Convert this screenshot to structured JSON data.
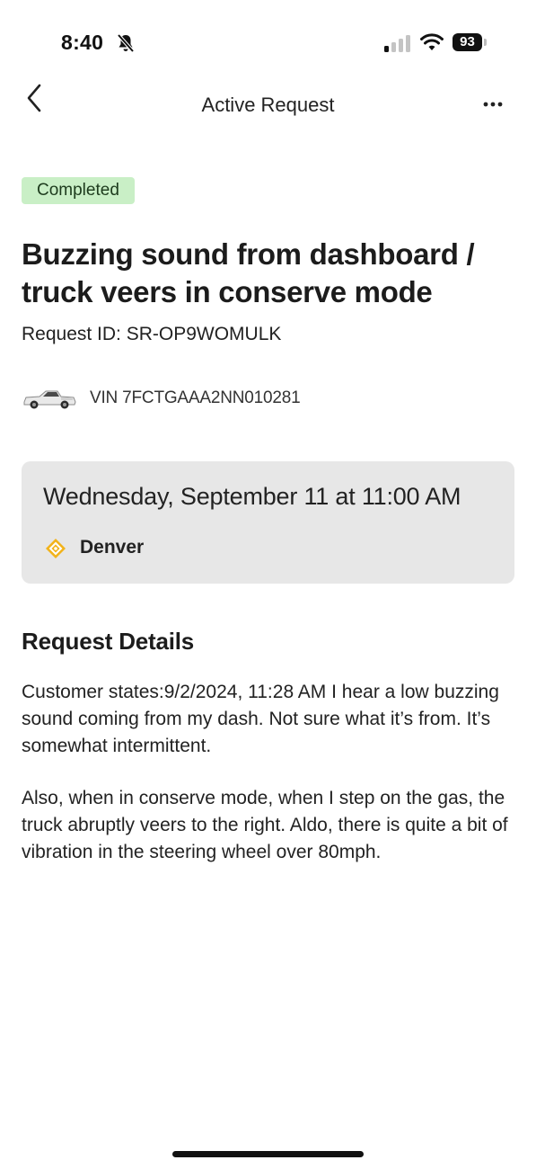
{
  "status_bar": {
    "time": "8:40",
    "battery_level": "93",
    "icons": [
      "bell-slash-icon",
      "cellular-signal-icon",
      "wifi-icon",
      "battery-icon"
    ]
  },
  "nav": {
    "title": "Active Request",
    "back_icon": "chevron-left-icon",
    "more_icon": "more-horizontal-icon"
  },
  "request": {
    "status_badge": "Completed",
    "title": "Buzzing sound from dashboard / truck veers in conserve mode",
    "request_id": "Request ID: SR-OP9WOMULK",
    "vin": "VIN 7FCTGAAA2NN010281"
  },
  "appointment": {
    "datetime": "Wednesday, September 11 at 11:00 AM",
    "location": "Denver",
    "location_icon": "service-center-diamond-icon"
  },
  "details": {
    "heading": "Request Details",
    "paragraph_1": "Customer states:9/2/2024, 11:28 AM I hear a low buzzing sound coming from my dash. Not sure what it’s from. It’s somewhat intermittent.",
    "paragraph_2": "Also, when in conserve mode, when I step on the gas, the truck abruptly veers to the right. Aldo, there is quite a bit of vibration in the steering wheel over 80mph."
  },
  "colors": {
    "badge_bg": "#c9efc6",
    "card_bg": "#e7e7e7",
    "location_icon": "#f2b31b"
  }
}
